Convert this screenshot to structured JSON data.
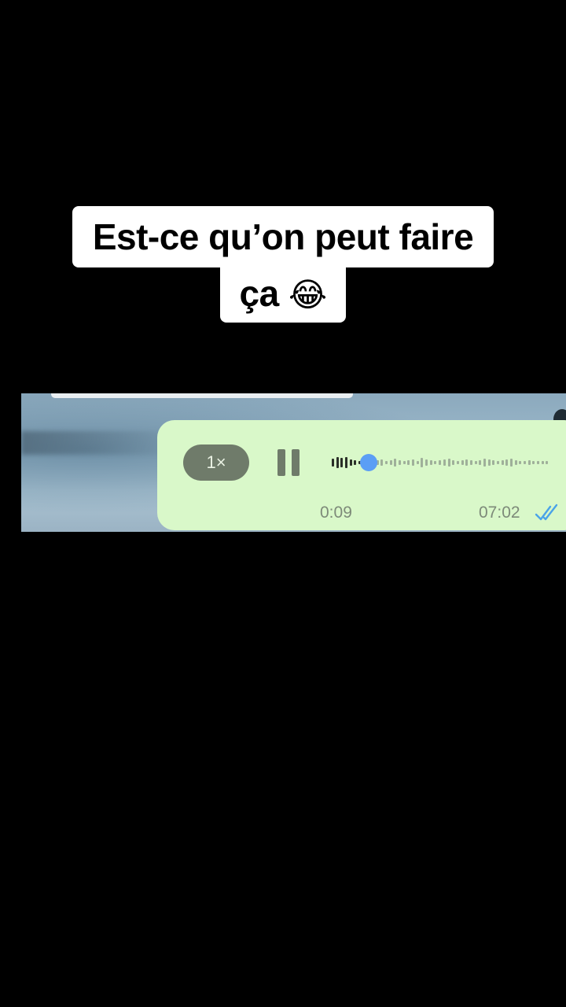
{
  "caption": {
    "line1": "Est-ce qu’on peut faire",
    "line2": "ça",
    "emoji": "😂"
  },
  "voice_message": {
    "speed_label": "1×",
    "elapsed": "0:09",
    "sent_time": "07:02",
    "progress": 0.17,
    "status": "read",
    "colors": {
      "bubble": "#d9f8c9",
      "control": "#6f7b6a",
      "played": "#2a2f28",
      "unplayed": "#9fb09a",
      "knob": "#5b9ef5",
      "read_ticks": "#4aa3e8"
    },
    "icons": [
      "pause-icon",
      "double-check-icon"
    ]
  }
}
